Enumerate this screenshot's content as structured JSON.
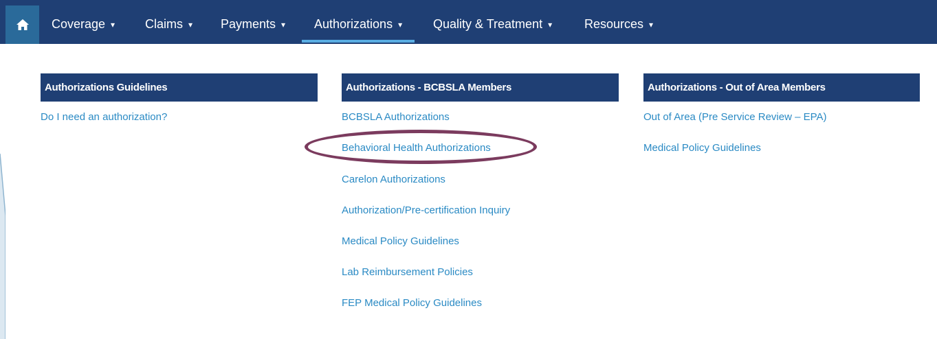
{
  "nav": {
    "home_icon": "home-icon",
    "items": [
      {
        "label": "Coverage"
      },
      {
        "label": "Claims"
      },
      {
        "label": "Payments"
      },
      {
        "label": "Authorizations",
        "active": true
      },
      {
        "label": "Quality & Treatment"
      },
      {
        "label": "Resources"
      }
    ],
    "caret_icon": "caret-down-icon",
    "colors": {
      "bar": "#1f3f74",
      "home": "#2a6a9a",
      "active_underline": "#5aaee3"
    }
  },
  "columns": [
    {
      "heading": "Authorizations Guidelines",
      "links": [
        "Do I need an authorization?"
      ]
    },
    {
      "heading": "Authorizations - BCBSLA Members",
      "links": [
        "BCBSLA Authorizations",
        "Behavioral Health Authorizations",
        "Carelon Authorizations",
        "Authorization/Pre-certification Inquiry",
        "Medical Policy Guidelines",
        "Lab Reimbursement Policies",
        "FEP Medical Policy Guidelines"
      ]
    },
    {
      "heading": "Authorizations - Out of Area Members",
      "links": [
        "Out of Area (Pre Service Review – EPA)",
        "Medical Policy Guidelines"
      ]
    }
  ],
  "annotation": {
    "highlight_color": "#7b3b5e"
  },
  "link_color": "#2a8ac4"
}
